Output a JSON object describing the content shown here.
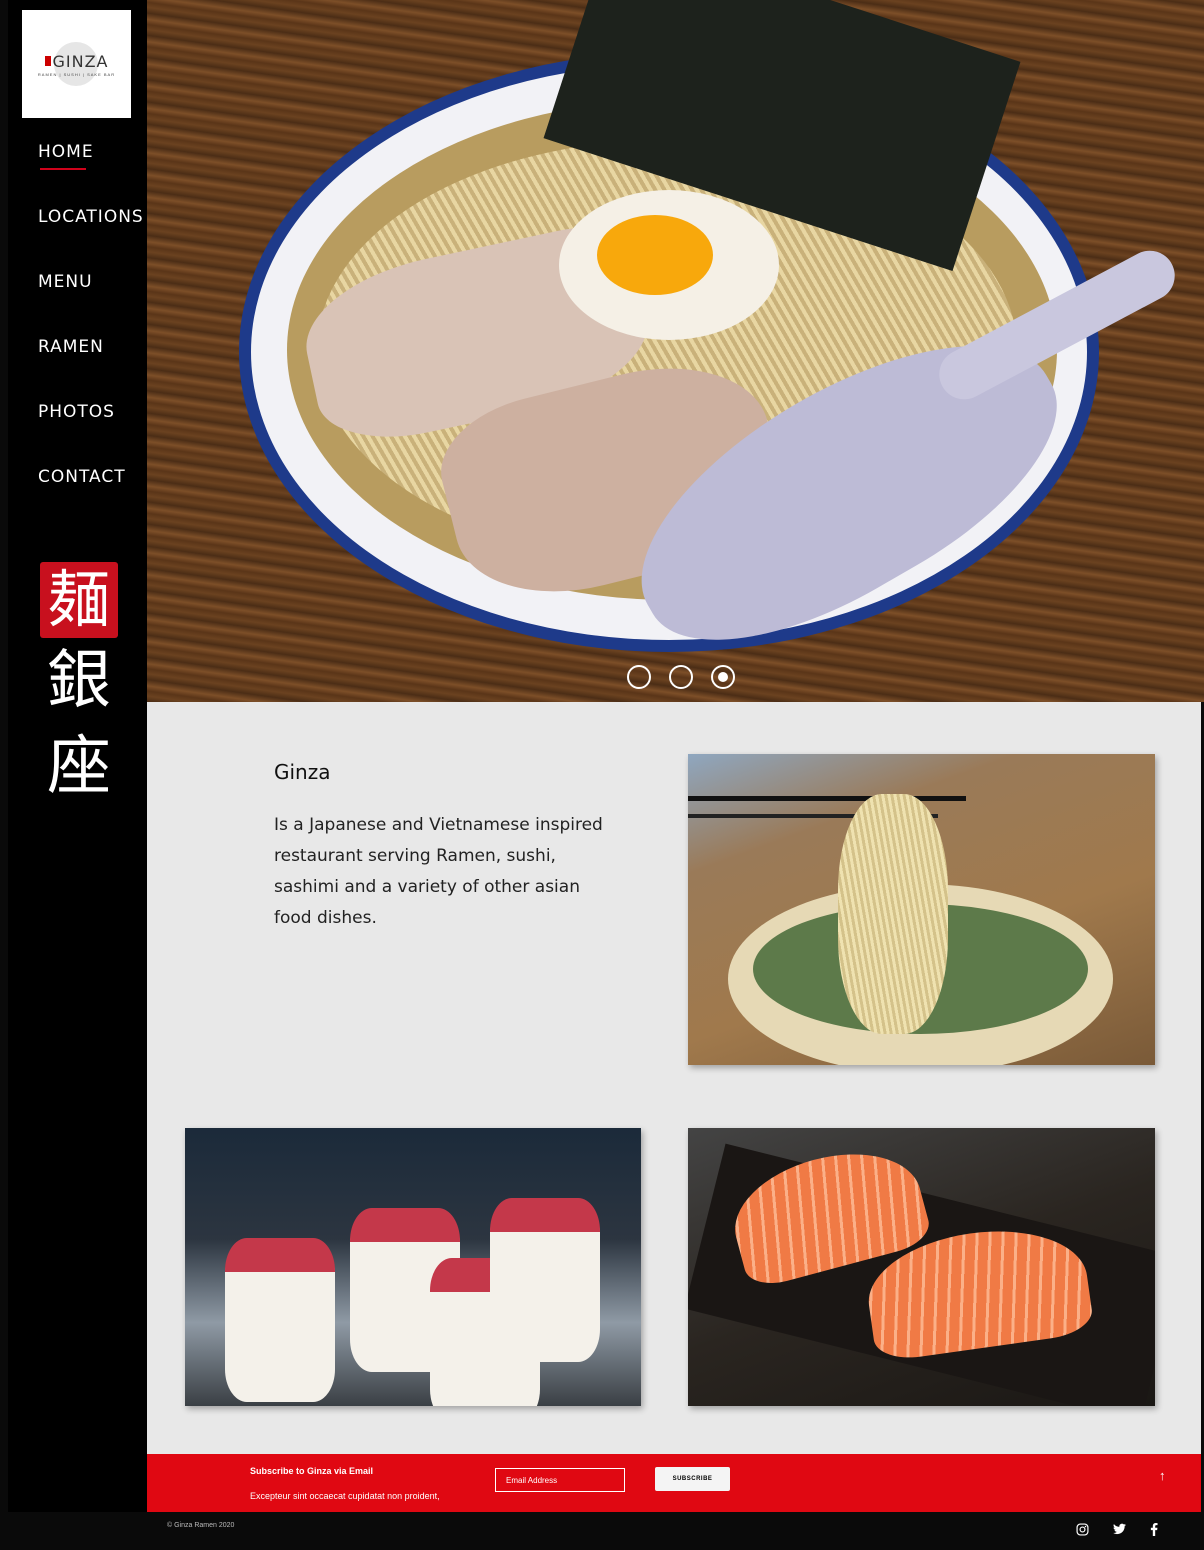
{
  "brand": {
    "logo_name": "GINZA",
    "logo_tagline": "RAMEN | SUSHI | SAKE BAR",
    "kanji_red": "麺",
    "kanji_white_1": "銀",
    "kanji_white_2": "座"
  },
  "nav": {
    "items": [
      {
        "label": "HOME",
        "active": true
      },
      {
        "label": "LOCATIONS"
      },
      {
        "label": "MENU"
      },
      {
        "label": "RAMEN"
      },
      {
        "label": "PHOTOS"
      },
      {
        "label": "CONTACT"
      }
    ]
  },
  "carousel": {
    "slide_count": 3,
    "active_index": 2
  },
  "intro": {
    "title": "Ginza",
    "text": "Is a Japanese and Vietnamese inspired restaurant serving Ramen, sushi, sashimi and a variety of other asian food dishes."
  },
  "subscribe": {
    "title": "Subscribe to Ginza via Email",
    "description": "Excepteur sint occaecat cupidatat non proident,",
    "email_placeholder": "Email Address",
    "button_label": "SUBSCRIBE",
    "back_to_top_icon": "arrow-up-icon"
  },
  "footer": {
    "copyright": "© Ginza Ramen 2020",
    "social": [
      "instagram-icon",
      "twitter-icon",
      "facebook-icon"
    ]
  },
  "colors": {
    "accent_red": "#e00812",
    "sidebar_bg": "#000000",
    "content_bg": "#e8e8e8"
  }
}
